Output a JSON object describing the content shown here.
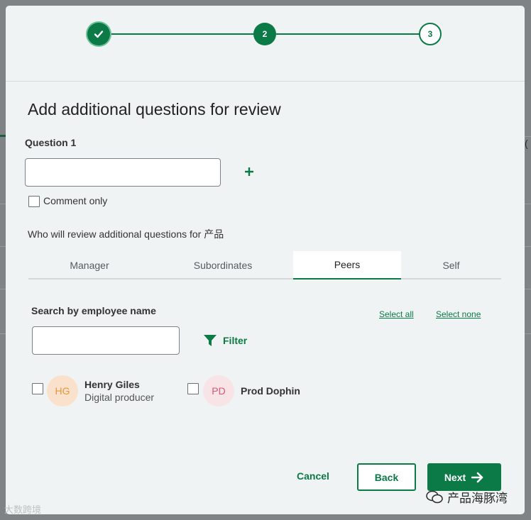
{
  "background": {
    "edge_text": "("
  },
  "stepper": {
    "steps": [
      {
        "label": "",
        "state": "done"
      },
      {
        "label": "2",
        "state": "current"
      },
      {
        "label": "3",
        "state": "upcoming"
      }
    ]
  },
  "title": "Add additional questions for review",
  "question": {
    "label": "Question 1",
    "value": "",
    "placeholder": ""
  },
  "comment_only": {
    "label": "Comment only",
    "checked": false
  },
  "reviewers": {
    "label": "Who will review additional questions for 产品",
    "tabs": [
      {
        "label": "Manager",
        "active": false
      },
      {
        "label": "Subordinates",
        "active": false
      },
      {
        "label": "Peers",
        "active": true
      },
      {
        "label": "Self",
        "active": false
      }
    ]
  },
  "search": {
    "label": "Search by employee name",
    "value": "",
    "select_all": "Select all",
    "select_none": "Select none",
    "filter_label": "Filter"
  },
  "employees": [
    {
      "initials": "HG",
      "name": "Henry Giles",
      "role": "Digital producer",
      "checked": false,
      "avatar_bg": "#f9e1cc",
      "avatar_fg": "#e6953f"
    },
    {
      "initials": "PD",
      "name": "Prod Dophin",
      "role": "",
      "checked": false,
      "avatar_bg": "#f8e3e7",
      "avatar_fg": "#d65a76"
    }
  ],
  "footer": {
    "cancel": "Cancel",
    "back": "Back",
    "next": "Next"
  },
  "watermarks": {
    "left": "大数跨境",
    "right": "产品海豚湾"
  },
  "colors": {
    "accent": "#0b7a47",
    "modal_bg": "#eff3f3"
  }
}
